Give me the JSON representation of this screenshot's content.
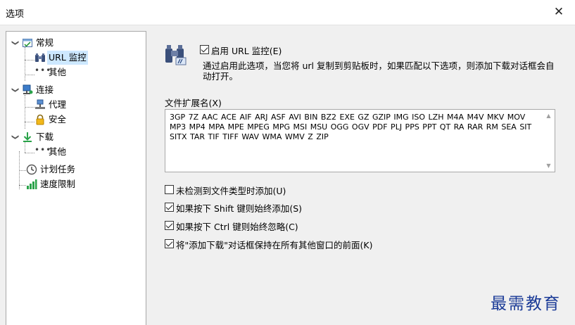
{
  "window": {
    "title": "选项",
    "close_glyph": "✕"
  },
  "tree": {
    "items": [
      {
        "label": "常规",
        "icon": "general-settings-icon"
      },
      {
        "label": "URL 监控",
        "icon": "binoculars-icon"
      },
      {
        "label": "其他",
        "icon": "ellipsis-icon"
      },
      {
        "label": "连接",
        "icon": "network-icon"
      },
      {
        "label": "代理",
        "icon": "proxy-icon"
      },
      {
        "label": "安全",
        "icon": "lock-icon"
      },
      {
        "label": "下载",
        "icon": "download-arrow-icon"
      },
      {
        "label": "其他",
        "icon": "ellipsis-icon"
      },
      {
        "label": "计划任务",
        "icon": "clock-icon"
      },
      {
        "label": "速度限制",
        "icon": "speed-bars-icon"
      }
    ],
    "selected": "URL 监控"
  },
  "url_monitor": {
    "enable_label": "启用 URL 监控(E)",
    "enable_checked": true,
    "description": "通过启用此选项，当您将 url 复制到剪贴板时，如果匹配以下选项，则添加下载对话框会自动打开。"
  },
  "extensions": {
    "label": "文件扩展名(X)",
    "value": "3GP 7Z AAC ACE AIF ARJ ASF AVI BIN BZ2 EXE GZ GZIP IMG ISO LZH M4A M4V MKV MOV MP3 MP4 MPA MPE MPEG MPG MSI MSU OGG OGV PDF PLJ PPS PPT QT RA RAR RM SEA SIT SITX TAR TIF TIFF WAV WMA WMV Z ZIP"
  },
  "options": [
    {
      "label": "未检测到文件类型时添加(U)",
      "checked": false
    },
    {
      "label": "如果按下 Shift 键则始终添加(S)",
      "checked": true
    },
    {
      "label": "如果按下 Ctrl 键则始终忽略(C)",
      "checked": true
    },
    {
      "label": "将\"添加下载\"对话框保持在所有其他窗口的前面(K)",
      "checked": true
    }
  ],
  "watermark": "最需教育",
  "colors": {
    "selection": "#cde8ff",
    "accent_blue": "#1b3b97"
  }
}
